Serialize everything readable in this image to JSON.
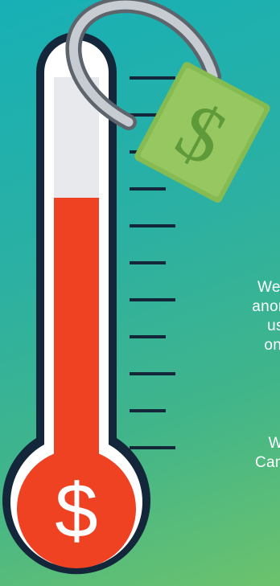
{
  "colors": {
    "background_top": "#17b0b6",
    "background_bottom": "#6cc26c",
    "thermometer_outline": "#14273a",
    "thermometer_tube": "#e8e9ec",
    "mercury": "#ef4223",
    "tick": "#14273a",
    "lock_body": "#8fc25a",
    "lock_shackle": "#b6bcc3"
  },
  "thermometer": {
    "bulb_symbol": "$",
    "fill_fraction": 0.7,
    "tick_count": 11
  },
  "lock": {
    "symbol": "$",
    "icon": "open-padlock-icon"
  },
  "message": {
    "lines": [
      "We ha",
      "anonym",
      "us t",
      "on A"
    ]
  },
  "cta": {
    "lines": [
      "We",
      "Can yo"
    ]
  }
}
